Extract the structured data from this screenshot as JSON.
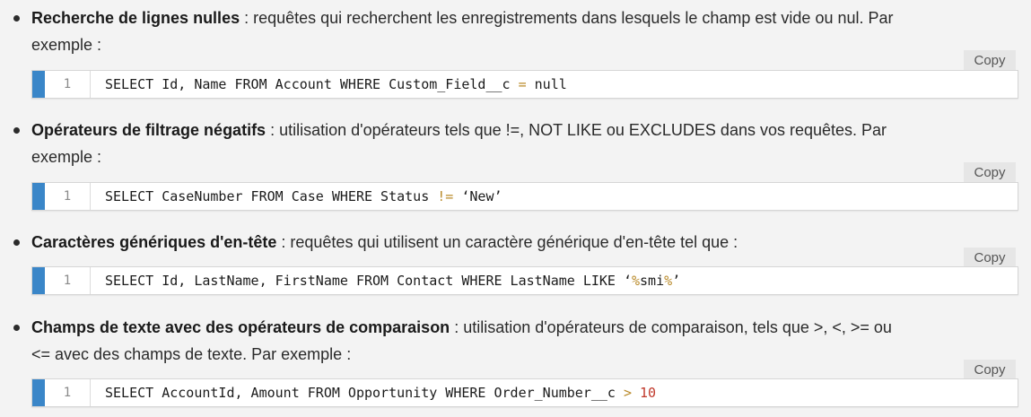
{
  "colors": {
    "background": "#f3f3f3",
    "code_accent": "#3a86c8",
    "operator": "#b98a2a",
    "number": "#c0392b"
  },
  "items": [
    {
      "title": "Recherche de lignes nulles",
      "text_line1": " : requêtes qui recherchent les enregistrements dans lesquels le champ est vide ou nul. Par",
      "text_line2": "exemple :",
      "copy_label": "Copy",
      "code": {
        "line_number": "1",
        "before": "SELECT Id, Name FROM Account WHERE Custom_Field__c ",
        "op": "=",
        "after": " null"
      }
    },
    {
      "title": "Opérateurs de filtrage négatifs",
      "text_line1": " : utilisation d'opérateurs tels que !=, NOT LIKE ou EXCLUDES dans vos requêtes. Par",
      "text_line2": "exemple :",
      "copy_label": "Copy",
      "code": {
        "line_number": "1",
        "before": "SELECT CaseNumber FROM Case WHERE Status ",
        "op": "!=",
        "after": " ‘New’"
      }
    },
    {
      "title": "Caractères génériques d'en-tête",
      "text_line1": " : requêtes qui utilisent un caractère générique d'en-tête tel que :",
      "copy_label": "Copy",
      "code": {
        "line_number": "1",
        "before": "SELECT Id, LastName, FirstName FROM Contact WHERE LastName LIKE ‘",
        "op": "%",
        "mid": "smi",
        "op2": "%",
        "after": "’"
      }
    },
    {
      "title": "Champs de texte avec des opérateurs de comparaison",
      "text_line1": " : utilisation d'opérateurs de comparaison, tels que >, <, >= ou",
      "text_line2": "<= avec des champs de texte. Par exemple :",
      "copy_label": "Copy",
      "code": {
        "line_number": "1",
        "before": "SELECT AccountId, Amount FROM Opportunity WHERE Order_Number__c ",
        "op": ">",
        "num": " 10"
      }
    }
  ]
}
